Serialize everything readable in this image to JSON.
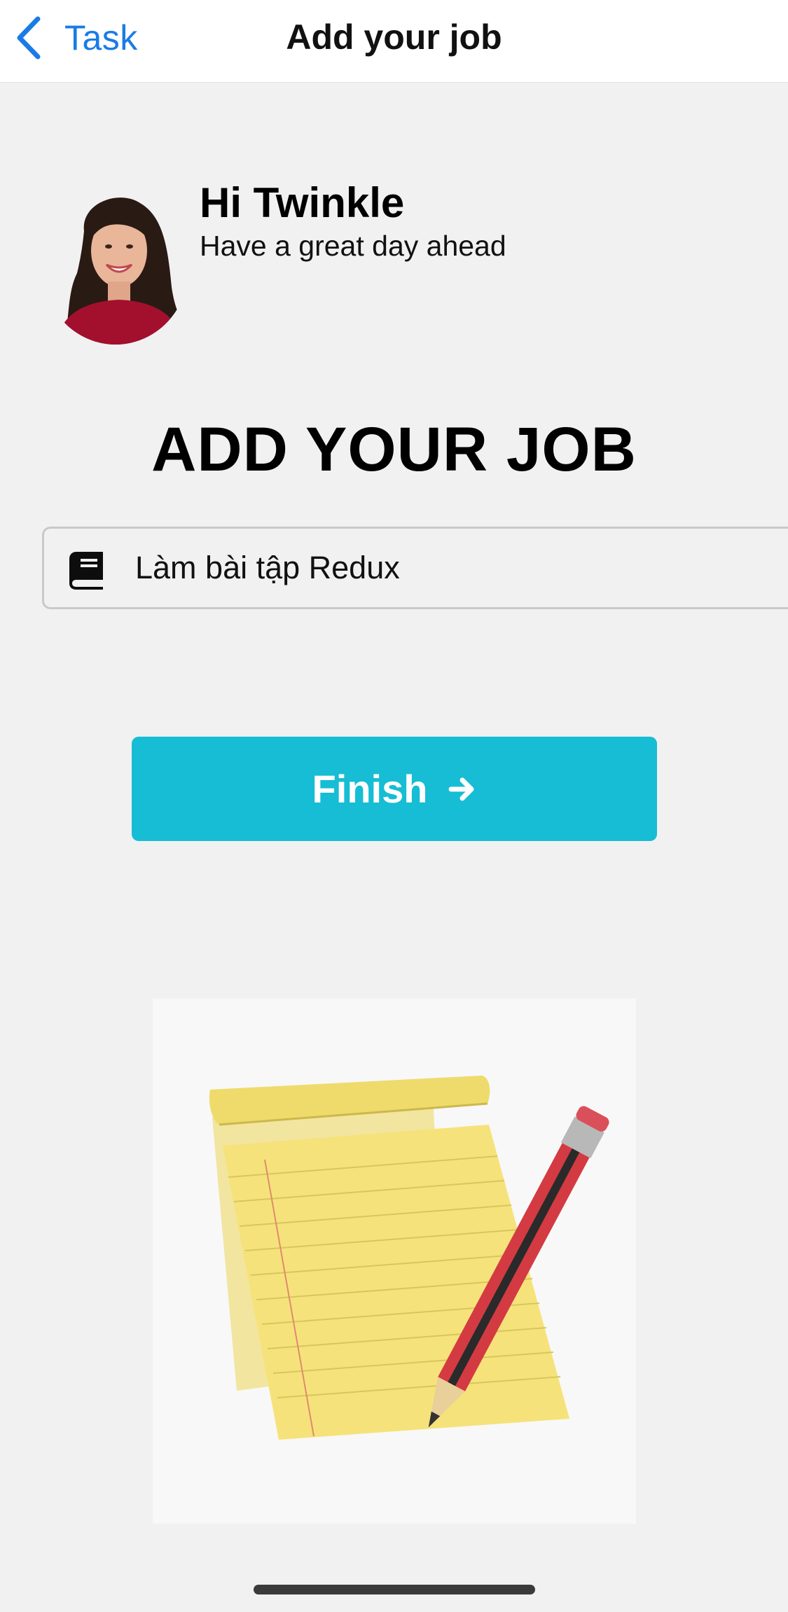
{
  "navbar": {
    "back_label": "Task",
    "title": "Add your job",
    "icons": {
      "back": "chevron-left-icon"
    },
    "accent_color": "#1a7be6"
  },
  "greeting": {
    "name": "Hi Twinkle",
    "subtitle": "Have a great day ahead"
  },
  "heading": "ADD YOUR JOB",
  "job_input": {
    "value": "Làm bài tập Redux",
    "icon": "book-icon"
  },
  "finish_button": {
    "label": "Finish",
    "icon": "arrow-right-icon",
    "color": "#16bdd4"
  },
  "illustration": {
    "icon": "notepad-pencil-icon"
  }
}
